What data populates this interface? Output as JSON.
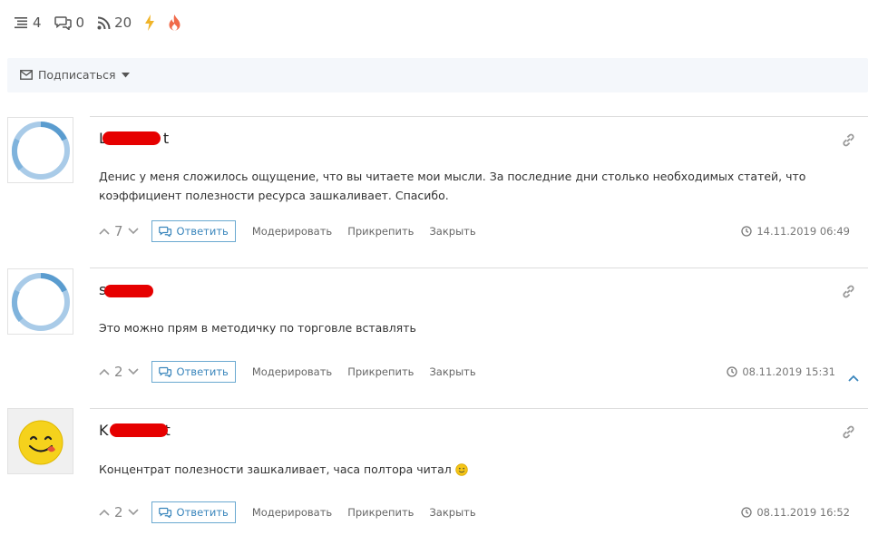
{
  "stats": {
    "posts": "4",
    "comments": "0",
    "rss": "20"
  },
  "subscribe": {
    "label": "Подписаться"
  },
  "comments": [
    {
      "author": "L",
      "author_tail": "t",
      "text": "Денис у меня сложилось ощущение, что вы читаете мои мысли. За последние дни столько необходимых статей, что коэффициент полезности ресурса зашкаливает. Спасибо.",
      "votes": "7",
      "reply": "Ответить",
      "moderate": "Модерировать",
      "pin": "Прикрепить",
      "close": "Закрыть",
      "date": "14.11.2019 06:49"
    },
    {
      "author": "s",
      "author_tail": "",
      "text": "Это можно прям в методичку по торговле вставлять",
      "votes": "2",
      "reply": "Ответить",
      "moderate": "Модерировать",
      "pin": "Прикрепить",
      "close": "Закрыть",
      "date": "08.11.2019 15:31"
    },
    {
      "author": "K",
      "author_tail": "t",
      "text": "Концентрат полезности зашкаливает, часа полтора читал",
      "votes": "2",
      "reply": "Ответить",
      "moderate": "Модерировать",
      "pin": "Прикрепить",
      "close": "Закрыть",
      "date": "08.11.2019 16:52"
    }
  ],
  "colors": {
    "accent": "#3a86bc",
    "border": "#dddddd",
    "subscribe_bg": "#f4f7fb",
    "redaction": "#e60000"
  }
}
